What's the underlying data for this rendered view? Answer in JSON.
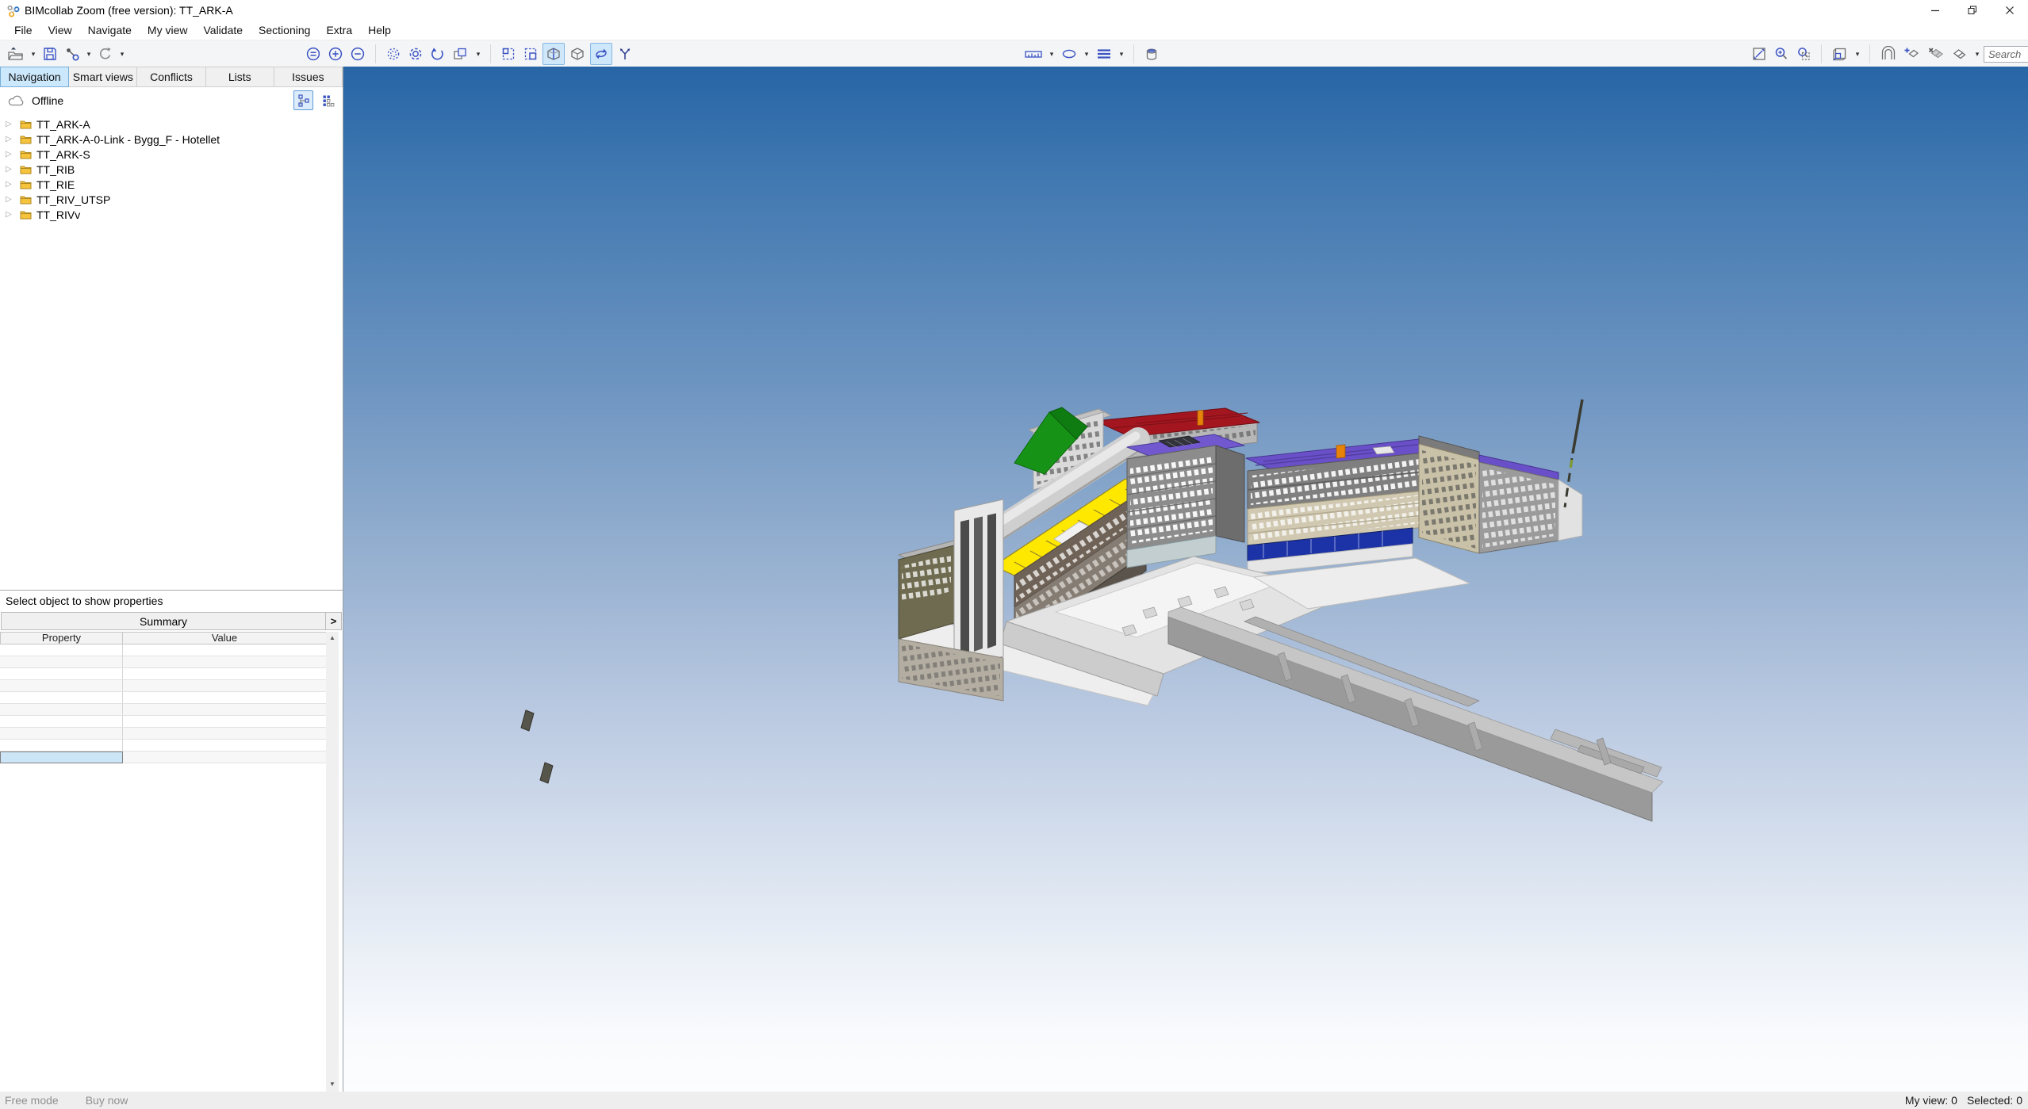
{
  "titlebar": {
    "title": "BIMcollab Zoom (free version): TT_ARK-A",
    "controls": [
      "minimize",
      "restore",
      "close"
    ]
  },
  "menu": {
    "items": [
      "File",
      "View",
      "Navigate",
      "My view",
      "Validate",
      "Sectioning",
      "Extra",
      "Help"
    ]
  },
  "toolbar": {
    "search_placeholder": "Search",
    "icon_names": [
      "open-model",
      "save",
      "merge-models",
      "sync",
      "zoom-extents",
      "zoom-in",
      "zoom-out",
      "spin-mode",
      "spin-mode-alt",
      "reset-view",
      "saved-views",
      "select-rect",
      "select-rect-alt",
      "section-box",
      "cube-view",
      "orbit",
      "walk",
      "measure-length",
      "measure-area",
      "measure-lines",
      "paint-bucket",
      "fit-view",
      "zoom-window",
      "zoom-selection",
      "hide-cube",
      "clip-arch",
      "add-section-plane",
      "remove-section-plane",
      "section-planes",
      "search"
    ],
    "active_toggles": [
      "section-box",
      "orbit"
    ]
  },
  "sidebar": {
    "tabs": [
      {
        "label": "Navigation",
        "active": true
      },
      {
        "label": "Smart views",
        "active": false
      },
      {
        "label": "Conflicts",
        "active": false
      },
      {
        "label": "Lists",
        "active": false
      },
      {
        "label": "Issues",
        "active": false
      }
    ],
    "connection_status": "Offline",
    "view_modes": [
      "tree-view",
      "grid-view"
    ],
    "tree": [
      "TT_ARK-A",
      "TT_ARK-A-0-Link - Bygg_F - Hotellet",
      "TT_ARK-S",
      "TT_RIB",
      "TT_RIE",
      "TT_RIV_UTSP",
      "TT_RIVv"
    ],
    "properties": {
      "hint": "Select object to show properties",
      "summary_label": "Summary",
      "columns": [
        "Property",
        "Value"
      ],
      "empty_row_count": 10
    }
  },
  "statusbar": {
    "mode": "Free mode",
    "buy": "Buy now",
    "my_view": "My view: 0",
    "selected": "Selected: 0"
  },
  "viewport": {
    "colors": {
      "sky_top": "#2765a6",
      "sky_bottom": "#fbfdfe",
      "roof_green": "#169316",
      "roof_red": "#a3161f",
      "roof_purple": "#6a50c8",
      "roof_yellow": "#ffe800",
      "band_blue": "#1c33a8",
      "facade_beige": "#d0c8b0",
      "facade_gray": "#8c8c8c",
      "concrete": "#c6c6c6",
      "accent_orange": "#e8830a"
    }
  }
}
